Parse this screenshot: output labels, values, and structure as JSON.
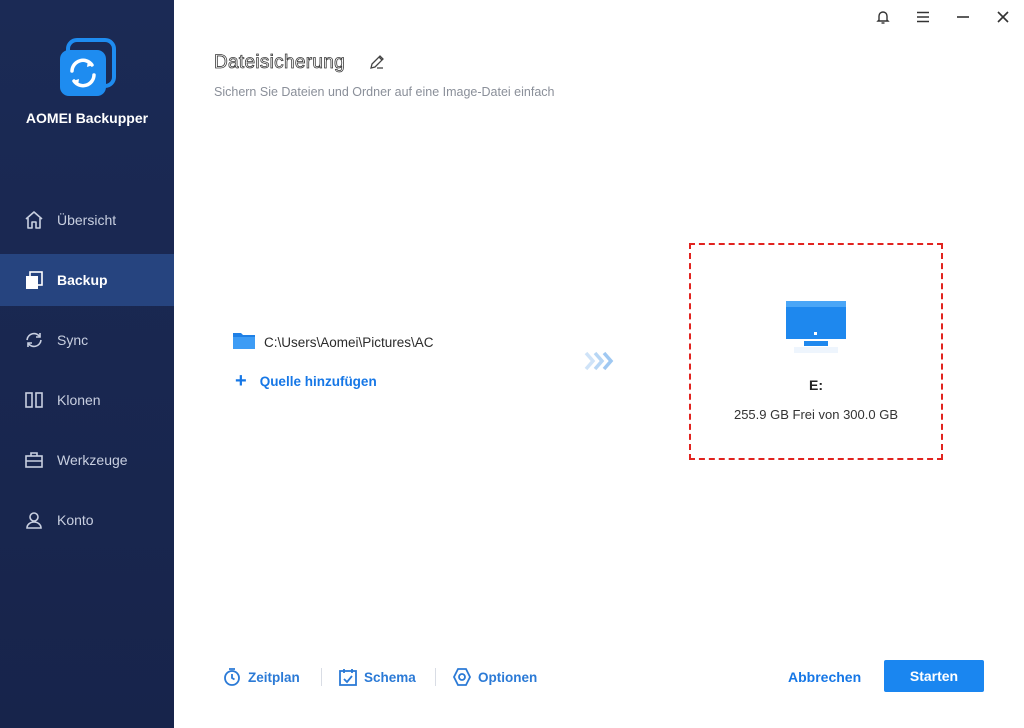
{
  "app": {
    "name": "AOMEI Backupper"
  },
  "sidebar": {
    "items": [
      {
        "label": "Übersicht",
        "icon": "home-icon",
        "active": false
      },
      {
        "label": "Backup",
        "icon": "backup-icon",
        "active": true
      },
      {
        "label": "Sync",
        "icon": "sync-icon",
        "active": false
      },
      {
        "label": "Klonen",
        "icon": "clone-icon",
        "active": false
      },
      {
        "label": "Werkzeuge",
        "icon": "tools-icon",
        "active": false
      },
      {
        "label": "Konto",
        "icon": "user-icon",
        "active": false
      }
    ]
  },
  "window_controls": [
    "bell-icon",
    "menu-icon",
    "minimize-icon",
    "close-icon"
  ],
  "header": {
    "title": "Dateisicherung",
    "subtitle": "Sichern Sie Dateien und Ordner auf eine Image-Datei einfach"
  },
  "source": {
    "path": "C:\\Users\\Aomei\\Pictures\\AC",
    "add_label": "Quelle hinzufügen"
  },
  "destination": {
    "drive": "E:",
    "space": "255.9 GB Frei von 300.0 GB"
  },
  "toolbar": {
    "schedule_label": "Zeitplan",
    "scheme_label": "Schema",
    "options_label": "Optionen"
  },
  "actions": {
    "cancel_label": "Abbrechen",
    "start_label": "Starten"
  },
  "colors": {
    "sidebar_bg": "#1b2a55",
    "sidebar_active": "#26447f",
    "accent": "#1a86f0",
    "highlight_border": "#e1231f"
  }
}
